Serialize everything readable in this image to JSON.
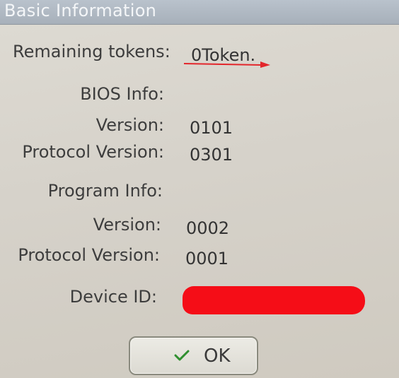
{
  "window": {
    "title": "Basic Information"
  },
  "tokens": {
    "label": "Remaining tokens:",
    "value": "0Token."
  },
  "bios": {
    "header": "BIOS Info:",
    "version_label": "Version:",
    "version_value": "0101",
    "protocol_label": "Protocol Version:",
    "protocol_value": "0301"
  },
  "program": {
    "header": "Program Info:",
    "version_label": "Version:",
    "version_value": "0002",
    "protocol_label": "Protocol Version:",
    "protocol_value": "0001"
  },
  "device": {
    "label": "Device ID:",
    "redaction_color": "#f50d17"
  },
  "buttons": {
    "ok_label": "OK",
    "ok_icon": "check-icon",
    "check_color": "#2f8f2f"
  },
  "annotation": {
    "arrow_color": "#e3262b"
  }
}
